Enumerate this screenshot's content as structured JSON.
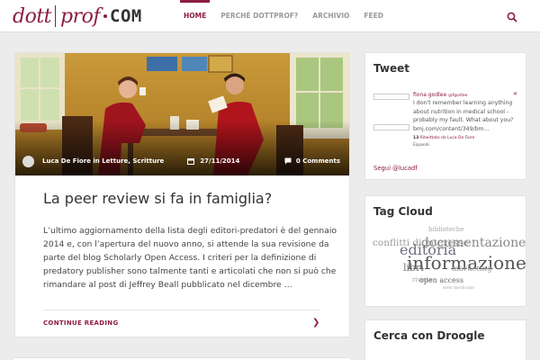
{
  "header": {
    "logo": {
      "part1": "dott",
      "part2": "prof",
      "part3": "COM"
    },
    "nav": [
      {
        "label": "HOME",
        "active": true
      },
      {
        "label": "PERCHÉ DOTTPROF?",
        "active": false
      },
      {
        "label": "ARCHIVIO",
        "active": false
      },
      {
        "label": "FEED",
        "active": false
      }
    ],
    "search_icon": "search-icon"
  },
  "post": {
    "author": "Luca De Fiore in Letture, Scritture",
    "date": "27/11/2014",
    "comments": "0 Comments",
    "title": "La peer review si fa in famiglia?",
    "excerpt": "L’ultimo aggiornamento della lista degli editori-predatori è del gennaio 2014 e, con l’apertura del nuovo anno, si attende la sua revisione da parte del blog Scholarly Open Access. I criteri per la definizione di predatory publisher sono talmente tanti e articolati che non si può che rimandare al post di Jeffrey Beall pubblicato nel dicembre …",
    "continue_label": "CONTINUE READING",
    "continue_arrow": "❯"
  },
  "sidebar": {
    "tweet": {
      "title": "Tweet",
      "user": "fiona godlee",
      "handle": "@fgodlee",
      "close": "✕",
      "text": "I don't remember learning anything about nutrition in medical school - probably my fault. What about you? bmj.com/content/349/bm…",
      "retweet_count": "13",
      "retweet_label": "Ritwittato da Luca De Fiore",
      "expand": "Espandi",
      "follow": "Segui @lucadf"
    },
    "tag_cloud": {
      "title": "Tag Cloud",
      "tags": [
        {
          "text": "biblioteche"
        },
        {
          "text": "conflitti di interesse"
        },
        {
          "text": "documentazione"
        },
        {
          "text": "editoria"
        },
        {
          "text": "informazione"
        },
        {
          "text": "marketing"
        },
        {
          "text": "libri"
        },
        {
          "text": "riviste"
        },
        {
          "text": "open access"
        },
        {
          "text": "new medicine"
        }
      ]
    },
    "droogle": {
      "title": "Cerca con Droogle"
    }
  },
  "colors": {
    "accent": "#8c1d40",
    "background": "#ececec",
    "card": "#ffffff"
  }
}
